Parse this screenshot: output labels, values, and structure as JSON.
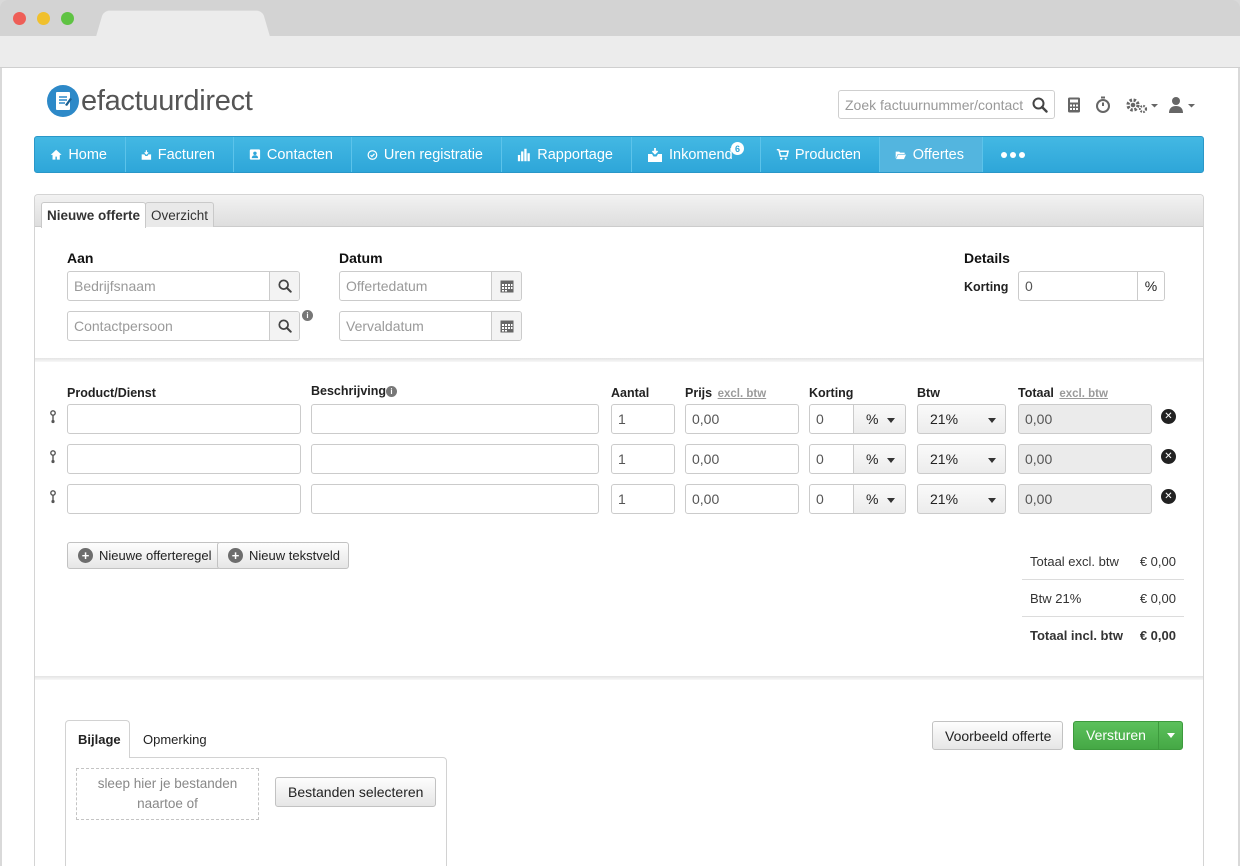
{
  "app": {
    "logo_prefix": "e",
    "logo_bold": "factuur",
    "logo_rest": "direct"
  },
  "header": {
    "search_placeholder": "Zoek factuurnummer/contact"
  },
  "nav": {
    "items": [
      {
        "label": "Home",
        "icon": "home-icon"
      },
      {
        "label": "Facturen",
        "icon": "inbox-icon"
      },
      {
        "label": "Contacten",
        "icon": "contact-card-icon"
      },
      {
        "label": "Uren registratie",
        "icon": "clock-icon"
      },
      {
        "label": "Rapportage",
        "icon": "bar-chart-icon"
      },
      {
        "label": "Inkomend",
        "icon": "inbox-icon",
        "badge": "6"
      },
      {
        "label": "Producten",
        "icon": "cart-icon"
      },
      {
        "label": "Offertes",
        "icon": "folder-open-icon",
        "active": true
      }
    ]
  },
  "tabs": {
    "new": "Nieuwe offerte",
    "overview": "Overzicht"
  },
  "form": {
    "to_label": "Aan",
    "company_placeholder": "Bedrijfsnaam",
    "contact_placeholder": "Contactpersoon",
    "date_label": "Datum",
    "quote_date_placeholder": "Offertedatum",
    "expiry_placeholder": "Vervaldatum",
    "details_label": "Details",
    "discount_label": "Korting",
    "discount_value": "0",
    "discount_unit": "%"
  },
  "lines": {
    "headers": {
      "product": "Product/Dienst",
      "description": "Beschrijving",
      "qty": "Aantal",
      "price": "Prijs",
      "price_sub": "excl. btw",
      "discount": "Korting",
      "vat": "Btw",
      "total": "Totaal",
      "total_sub": "excl. btw"
    },
    "rows": [
      {
        "qty": "1",
        "price": "0,00",
        "discount": "0",
        "unit": "%",
        "vat": "21%",
        "total": "0,00"
      },
      {
        "qty": "1",
        "price": "0,00",
        "discount": "0",
        "unit": "%",
        "vat": "21%",
        "total": "0,00"
      },
      {
        "qty": "1",
        "price": "0,00",
        "discount": "0",
        "unit": "%",
        "vat": "21%",
        "total": "0,00"
      }
    ],
    "add_line": "Nieuwe offerteregel",
    "add_text": "Nieuw tekstveld"
  },
  "totals": {
    "excl_label": "Totaal excl. btw",
    "excl_value": "€ 0,00",
    "vat_label": "Btw 21%",
    "vat_value": "€ 0,00",
    "incl_label": "Totaal incl. btw",
    "incl_value": "€ 0,00"
  },
  "bottom": {
    "tab_attachment": "Bijlage",
    "tab_remark": "Opmerking",
    "dropzone_line1": "sleep hier je bestanden",
    "dropzone_line2": "naartoe of",
    "select_files": "Bestanden selecteren",
    "preview": "Voorbeeld offerte",
    "send": "Versturen"
  }
}
